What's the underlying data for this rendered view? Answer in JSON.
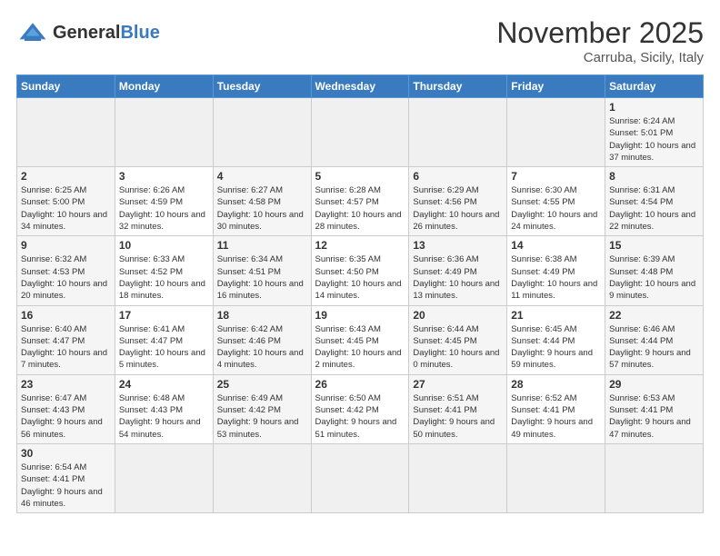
{
  "header": {
    "logo_general": "General",
    "logo_blue": "Blue",
    "month_title": "November 2025",
    "location": "Carruba, Sicily, Italy"
  },
  "days_of_week": [
    "Sunday",
    "Monday",
    "Tuesday",
    "Wednesday",
    "Thursday",
    "Friday",
    "Saturday"
  ],
  "weeks": [
    [
      {
        "day": "",
        "info": ""
      },
      {
        "day": "",
        "info": ""
      },
      {
        "day": "",
        "info": ""
      },
      {
        "day": "",
        "info": ""
      },
      {
        "day": "",
        "info": ""
      },
      {
        "day": "",
        "info": ""
      },
      {
        "day": "1",
        "info": "Sunrise: 6:24 AM\nSunset: 5:01 PM\nDaylight: 10 hours and 37 minutes."
      }
    ],
    [
      {
        "day": "2",
        "info": "Sunrise: 6:25 AM\nSunset: 5:00 PM\nDaylight: 10 hours and 34 minutes."
      },
      {
        "day": "3",
        "info": "Sunrise: 6:26 AM\nSunset: 4:59 PM\nDaylight: 10 hours and 32 minutes."
      },
      {
        "day": "4",
        "info": "Sunrise: 6:27 AM\nSunset: 4:58 PM\nDaylight: 10 hours and 30 minutes."
      },
      {
        "day": "5",
        "info": "Sunrise: 6:28 AM\nSunset: 4:57 PM\nDaylight: 10 hours and 28 minutes."
      },
      {
        "day": "6",
        "info": "Sunrise: 6:29 AM\nSunset: 4:56 PM\nDaylight: 10 hours and 26 minutes."
      },
      {
        "day": "7",
        "info": "Sunrise: 6:30 AM\nSunset: 4:55 PM\nDaylight: 10 hours and 24 minutes."
      },
      {
        "day": "8",
        "info": "Sunrise: 6:31 AM\nSunset: 4:54 PM\nDaylight: 10 hours and 22 minutes."
      }
    ],
    [
      {
        "day": "9",
        "info": "Sunrise: 6:32 AM\nSunset: 4:53 PM\nDaylight: 10 hours and 20 minutes."
      },
      {
        "day": "10",
        "info": "Sunrise: 6:33 AM\nSunset: 4:52 PM\nDaylight: 10 hours and 18 minutes."
      },
      {
        "day": "11",
        "info": "Sunrise: 6:34 AM\nSunset: 4:51 PM\nDaylight: 10 hours and 16 minutes."
      },
      {
        "day": "12",
        "info": "Sunrise: 6:35 AM\nSunset: 4:50 PM\nDaylight: 10 hours and 14 minutes."
      },
      {
        "day": "13",
        "info": "Sunrise: 6:36 AM\nSunset: 4:49 PM\nDaylight: 10 hours and 13 minutes."
      },
      {
        "day": "14",
        "info": "Sunrise: 6:38 AM\nSunset: 4:49 PM\nDaylight: 10 hours and 11 minutes."
      },
      {
        "day": "15",
        "info": "Sunrise: 6:39 AM\nSunset: 4:48 PM\nDaylight: 10 hours and 9 minutes."
      }
    ],
    [
      {
        "day": "16",
        "info": "Sunrise: 6:40 AM\nSunset: 4:47 PM\nDaylight: 10 hours and 7 minutes."
      },
      {
        "day": "17",
        "info": "Sunrise: 6:41 AM\nSunset: 4:47 PM\nDaylight: 10 hours and 5 minutes."
      },
      {
        "day": "18",
        "info": "Sunrise: 6:42 AM\nSunset: 4:46 PM\nDaylight: 10 hours and 4 minutes."
      },
      {
        "day": "19",
        "info": "Sunrise: 6:43 AM\nSunset: 4:45 PM\nDaylight: 10 hours and 2 minutes."
      },
      {
        "day": "20",
        "info": "Sunrise: 6:44 AM\nSunset: 4:45 PM\nDaylight: 10 hours and 0 minutes."
      },
      {
        "day": "21",
        "info": "Sunrise: 6:45 AM\nSunset: 4:44 PM\nDaylight: 9 hours and 59 minutes."
      },
      {
        "day": "22",
        "info": "Sunrise: 6:46 AM\nSunset: 4:44 PM\nDaylight: 9 hours and 57 minutes."
      }
    ],
    [
      {
        "day": "23",
        "info": "Sunrise: 6:47 AM\nSunset: 4:43 PM\nDaylight: 9 hours and 56 minutes."
      },
      {
        "day": "24",
        "info": "Sunrise: 6:48 AM\nSunset: 4:43 PM\nDaylight: 9 hours and 54 minutes."
      },
      {
        "day": "25",
        "info": "Sunrise: 6:49 AM\nSunset: 4:42 PM\nDaylight: 9 hours and 53 minutes."
      },
      {
        "day": "26",
        "info": "Sunrise: 6:50 AM\nSunset: 4:42 PM\nDaylight: 9 hours and 51 minutes."
      },
      {
        "day": "27",
        "info": "Sunrise: 6:51 AM\nSunset: 4:41 PM\nDaylight: 9 hours and 50 minutes."
      },
      {
        "day": "28",
        "info": "Sunrise: 6:52 AM\nSunset: 4:41 PM\nDaylight: 9 hours and 49 minutes."
      },
      {
        "day": "29",
        "info": "Sunrise: 6:53 AM\nSunset: 4:41 PM\nDaylight: 9 hours and 47 minutes."
      }
    ],
    [
      {
        "day": "30",
        "info": "Sunrise: 6:54 AM\nSunset: 4:41 PM\nDaylight: 9 hours and 46 minutes."
      },
      {
        "day": "",
        "info": ""
      },
      {
        "day": "",
        "info": ""
      },
      {
        "day": "",
        "info": ""
      },
      {
        "day": "",
        "info": ""
      },
      {
        "day": "",
        "info": ""
      },
      {
        "day": "",
        "info": ""
      }
    ]
  ]
}
